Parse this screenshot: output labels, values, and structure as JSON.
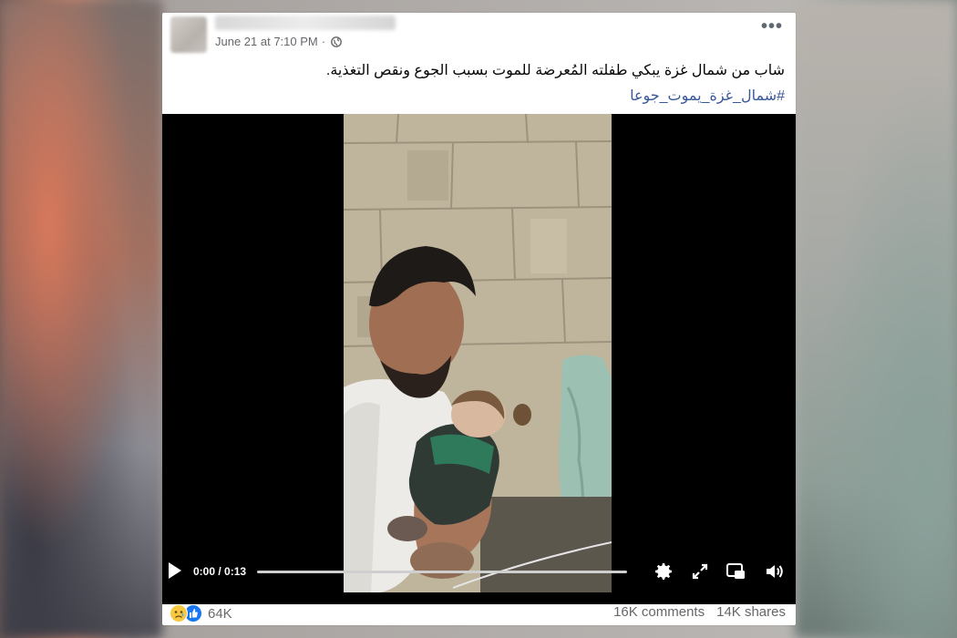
{
  "post": {
    "timestamp": "June 21 at 7:10 PM",
    "separator": "·",
    "privacy_icon": "globe-icon",
    "more_icon": "more-options-icon",
    "more_label": "•••",
    "caption": "شاب من شمال غزة يبكي طفلته المُعرضة للموت بسبب الجوع ونقص التغذية.",
    "hashtag": "#شمال_غزة_يموت_جوعا"
  },
  "video": {
    "time": "0:00 / 0:13",
    "progress": 0.0,
    "play_icon": "play-icon",
    "settings_icon": "gear-icon",
    "expand_icon": "expand-icon",
    "pip_icon": "picture-in-picture-icon",
    "volume_icon": "volume-icon"
  },
  "footer": {
    "reaction_icons": [
      "sad-reaction-icon",
      "like-reaction-icon"
    ],
    "reaction_count": "64K",
    "comments": "16K comments",
    "shares": "14K shares"
  },
  "colors": {
    "text": "#050505",
    "meta": "#65676b",
    "link": "#385898",
    "like_blue": "#1877f2",
    "sad_yellow": "#f7c942"
  }
}
